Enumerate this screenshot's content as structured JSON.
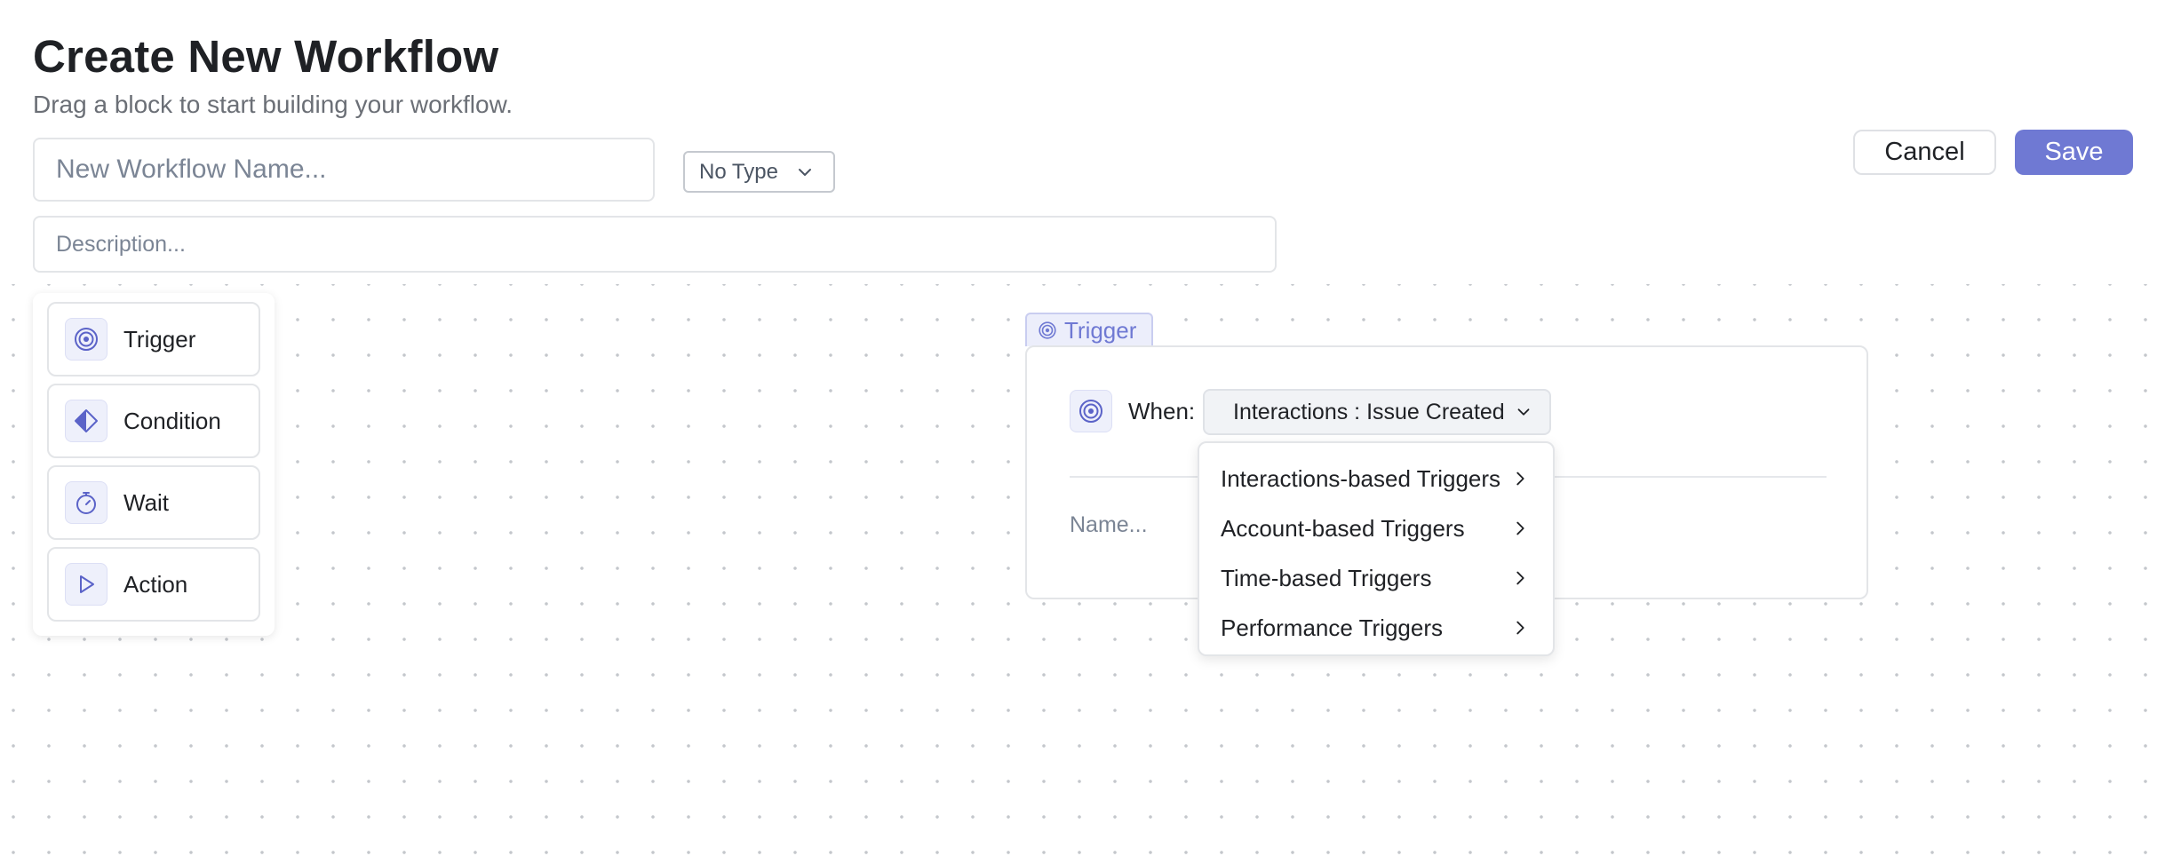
{
  "header": {
    "title": "Create New Workflow",
    "subtitle": "Drag a block to start building your workflow."
  },
  "form": {
    "name_placeholder": "New Workflow Name...",
    "type_value": "No Type",
    "description_placeholder": "Description..."
  },
  "actions": {
    "cancel_label": "Cancel",
    "save_label": "Save"
  },
  "palette": {
    "blocks": [
      {
        "label": "Trigger",
        "icon": "target-icon"
      },
      {
        "label": "Condition",
        "icon": "diamond-icon"
      },
      {
        "label": "Wait",
        "icon": "stopwatch-icon"
      },
      {
        "label": "Action",
        "icon": "play-icon"
      }
    ]
  },
  "trigger_node": {
    "tab_label": "Trigger",
    "when_label": "When:",
    "selected_trigger": "Interactions : Issue Created",
    "name_placeholder": "Name..."
  },
  "trigger_dropdown": {
    "items": [
      "Interactions-based Triggers",
      "Account-based Triggers",
      "Time-based Triggers",
      "Performance Triggers"
    ]
  },
  "colors": {
    "accent": "#6f79d3",
    "icon_bg": "#eef0fb",
    "border": "#e3e5e8"
  }
}
